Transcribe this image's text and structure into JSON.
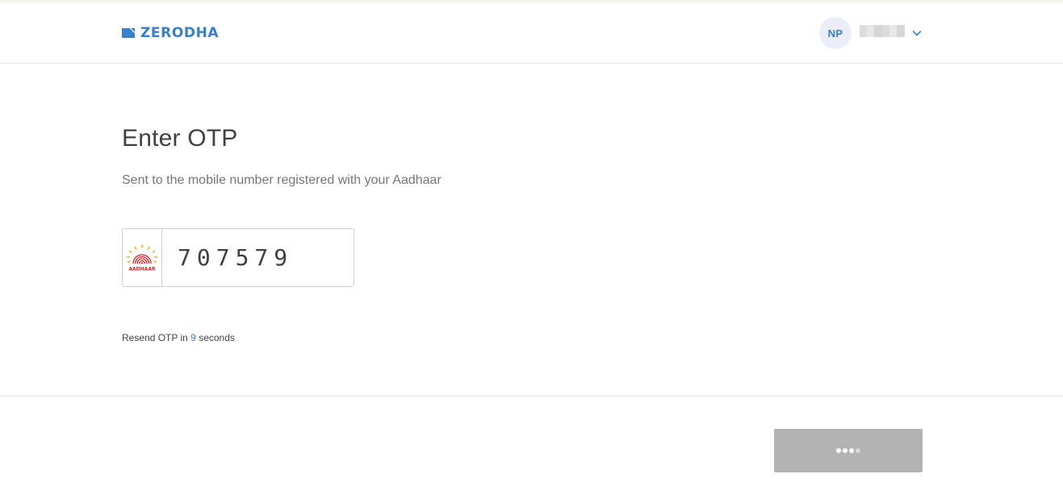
{
  "header": {
    "brand": "ZERODHA",
    "brand_color": "#387ed1",
    "user": {
      "initials": "NP",
      "name_redacted": true
    },
    "chevron_icon": "chevron-down-icon"
  },
  "main": {
    "title": "Enter OTP",
    "subtitle": "Sent to the mobile number registered with your Aadhaar",
    "otp": {
      "value": "707579",
      "icon": "aadhaar-logo"
    },
    "resend": {
      "prefix": "Resend OTP in",
      "countdown": "9",
      "suffix": "seconds"
    }
  },
  "footer": {
    "submit_button": {
      "state": "loading",
      "icon": "loading-dots-icon"
    }
  }
}
